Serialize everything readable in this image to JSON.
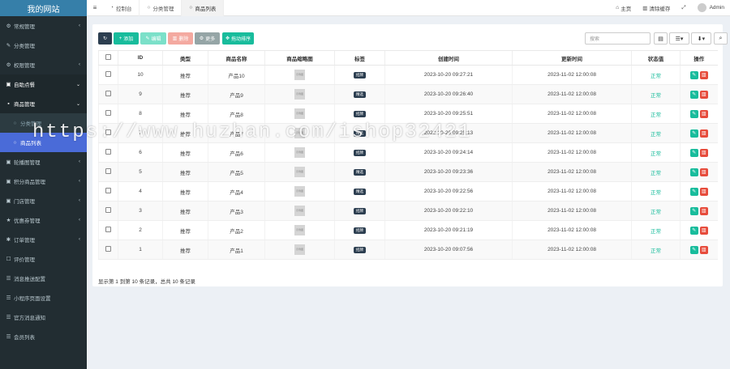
{
  "sidebar": {
    "logo": "我的网站",
    "items": [
      {
        "icon": "⚙",
        "label": "常规管理",
        "arrow": "‹",
        "type": "top"
      },
      {
        "icon": "✎",
        "label": "分类管理",
        "arrow": "",
        "type": "top"
      },
      {
        "icon": "⚙",
        "label": "权限管理",
        "arrow": "‹",
        "type": "top"
      },
      {
        "icon": "▣",
        "label": "自助点餐",
        "arrow": "⌄",
        "type": "open"
      },
      {
        "icon": "▪",
        "label": "商品管理",
        "arrow": "⌄",
        "type": "open"
      },
      {
        "icon": "○",
        "label": "分类管理",
        "arrow": "",
        "type": "sub"
      },
      {
        "icon": "○",
        "label": "商品列表",
        "arrow": "",
        "type": "active"
      },
      {
        "icon": "▣",
        "label": "轮播图管理",
        "arrow": "‹",
        "type": "top"
      },
      {
        "icon": "▣",
        "label": "积分商品管理",
        "arrow": "‹",
        "type": "top"
      },
      {
        "icon": "▣",
        "label": "门店管理",
        "arrow": "‹",
        "type": "top"
      },
      {
        "icon": "★",
        "label": "优惠券管理",
        "arrow": "‹",
        "type": "top"
      },
      {
        "icon": "✱",
        "label": "订单管理",
        "arrow": "‹",
        "type": "top"
      },
      {
        "icon": "☐",
        "label": "评价管理",
        "arrow": "",
        "type": "top"
      },
      {
        "icon": "☰",
        "label": "消息推送配置",
        "arrow": "",
        "type": "top"
      },
      {
        "icon": "☰",
        "label": "小程序页面设置",
        "arrow": "",
        "type": "top"
      },
      {
        "icon": "☰",
        "label": "官方消息通知",
        "arrow": "",
        "type": "top"
      },
      {
        "icon": "☰",
        "label": "会员列表",
        "arrow": "",
        "type": "top"
      }
    ]
  },
  "topbar": {
    "menu_icon": "≡",
    "tabs": [
      {
        "icon": "◔",
        "label": "控制台",
        "active": false
      },
      {
        "icon": "○",
        "label": "分类管理",
        "active": false
      },
      {
        "icon": "○",
        "label": "商品列表",
        "active": true
      }
    ],
    "home": "主页",
    "clear_cache": "清除缓存",
    "fullscreen": "⤢",
    "user": "Admin"
  },
  "toolbar": {
    "refresh": "↻",
    "add": "添加",
    "edit": "编辑",
    "delete": "删除",
    "more": "更多",
    "sort": "拖动排序",
    "search_placeholder": "搜索"
  },
  "table": {
    "headers": [
      "ID",
      "类型",
      "商品名称",
      "商品缩略图",
      "标签",
      "创建时间",
      "更新时间",
      "状态值",
      "操作"
    ],
    "rows": [
      {
        "id": "10",
        "type": "推荐",
        "name": "产品10",
        "thumb": "示例图",
        "tag": "招牌",
        "created": "2023-10-20 09:27:21",
        "updated": "2023-11-02 12:00:08",
        "status": "正常"
      },
      {
        "id": "9",
        "type": "推荐",
        "name": "产品9",
        "thumb": "示例图",
        "tag": "精选",
        "created": "2023-10-20 09:26:40",
        "updated": "2023-11-02 12:00:08",
        "status": "正常"
      },
      {
        "id": "8",
        "type": "推荐",
        "name": "产品8",
        "thumb": "示例图",
        "tag": "招牌",
        "created": "2023-10-20 09:25:51",
        "updated": "2023-11-02 12:00:08",
        "status": "正常"
      },
      {
        "id": "7",
        "type": "推荐",
        "name": "产品7",
        "thumb": "示例图",
        "tag": "精选",
        "created": "2023-10-20 09:25:13",
        "updated": "2023-11-02 12:00:08",
        "status": "正常"
      },
      {
        "id": "6",
        "type": "推荐",
        "name": "产品6",
        "thumb": "示例图",
        "tag": "招牌",
        "created": "2023-10-20 09:24:14",
        "updated": "2023-11-02 12:00:08",
        "status": "正常"
      },
      {
        "id": "5",
        "type": "推荐",
        "name": "产品5",
        "thumb": "示例图",
        "tag": "精选",
        "created": "2023-10-20 09:23:36",
        "updated": "2023-11-02 12:00:08",
        "status": "正常"
      },
      {
        "id": "4",
        "type": "推荐",
        "name": "产品4",
        "thumb": "示例图",
        "tag": "精选",
        "created": "2023-10-20 09:22:56",
        "updated": "2023-11-02 12:00:08",
        "status": "正常"
      },
      {
        "id": "3",
        "type": "推荐",
        "name": "产品3",
        "thumb": "示例图",
        "tag": "招牌",
        "created": "2023-10-20 09:22:10",
        "updated": "2023-11-02 12:00:08",
        "status": "正常"
      },
      {
        "id": "2",
        "type": "推荐",
        "name": "产品2",
        "thumb": "示例图",
        "tag": "招牌",
        "created": "2023-10-20 09:21:19",
        "updated": "2023-11-02 12:00:08",
        "status": "正常"
      },
      {
        "id": "1",
        "type": "推荐",
        "name": "产品1",
        "thumb": "示例图",
        "tag": "招牌",
        "created": "2023-10-20 09:07:56",
        "updated": "2023-11-02 12:00:08",
        "status": "正常"
      }
    ],
    "footer": "显示第 1 到第 10 条记录，总共 10 条记录"
  },
  "watermark": "https://www.huzhan.com/ishop32421",
  "colors": {
    "sidebar": "#222d32",
    "active": "#4a6bd8",
    "green": "#18bc9c",
    "red": "#e74c3c",
    "dark": "#2c3e50"
  }
}
